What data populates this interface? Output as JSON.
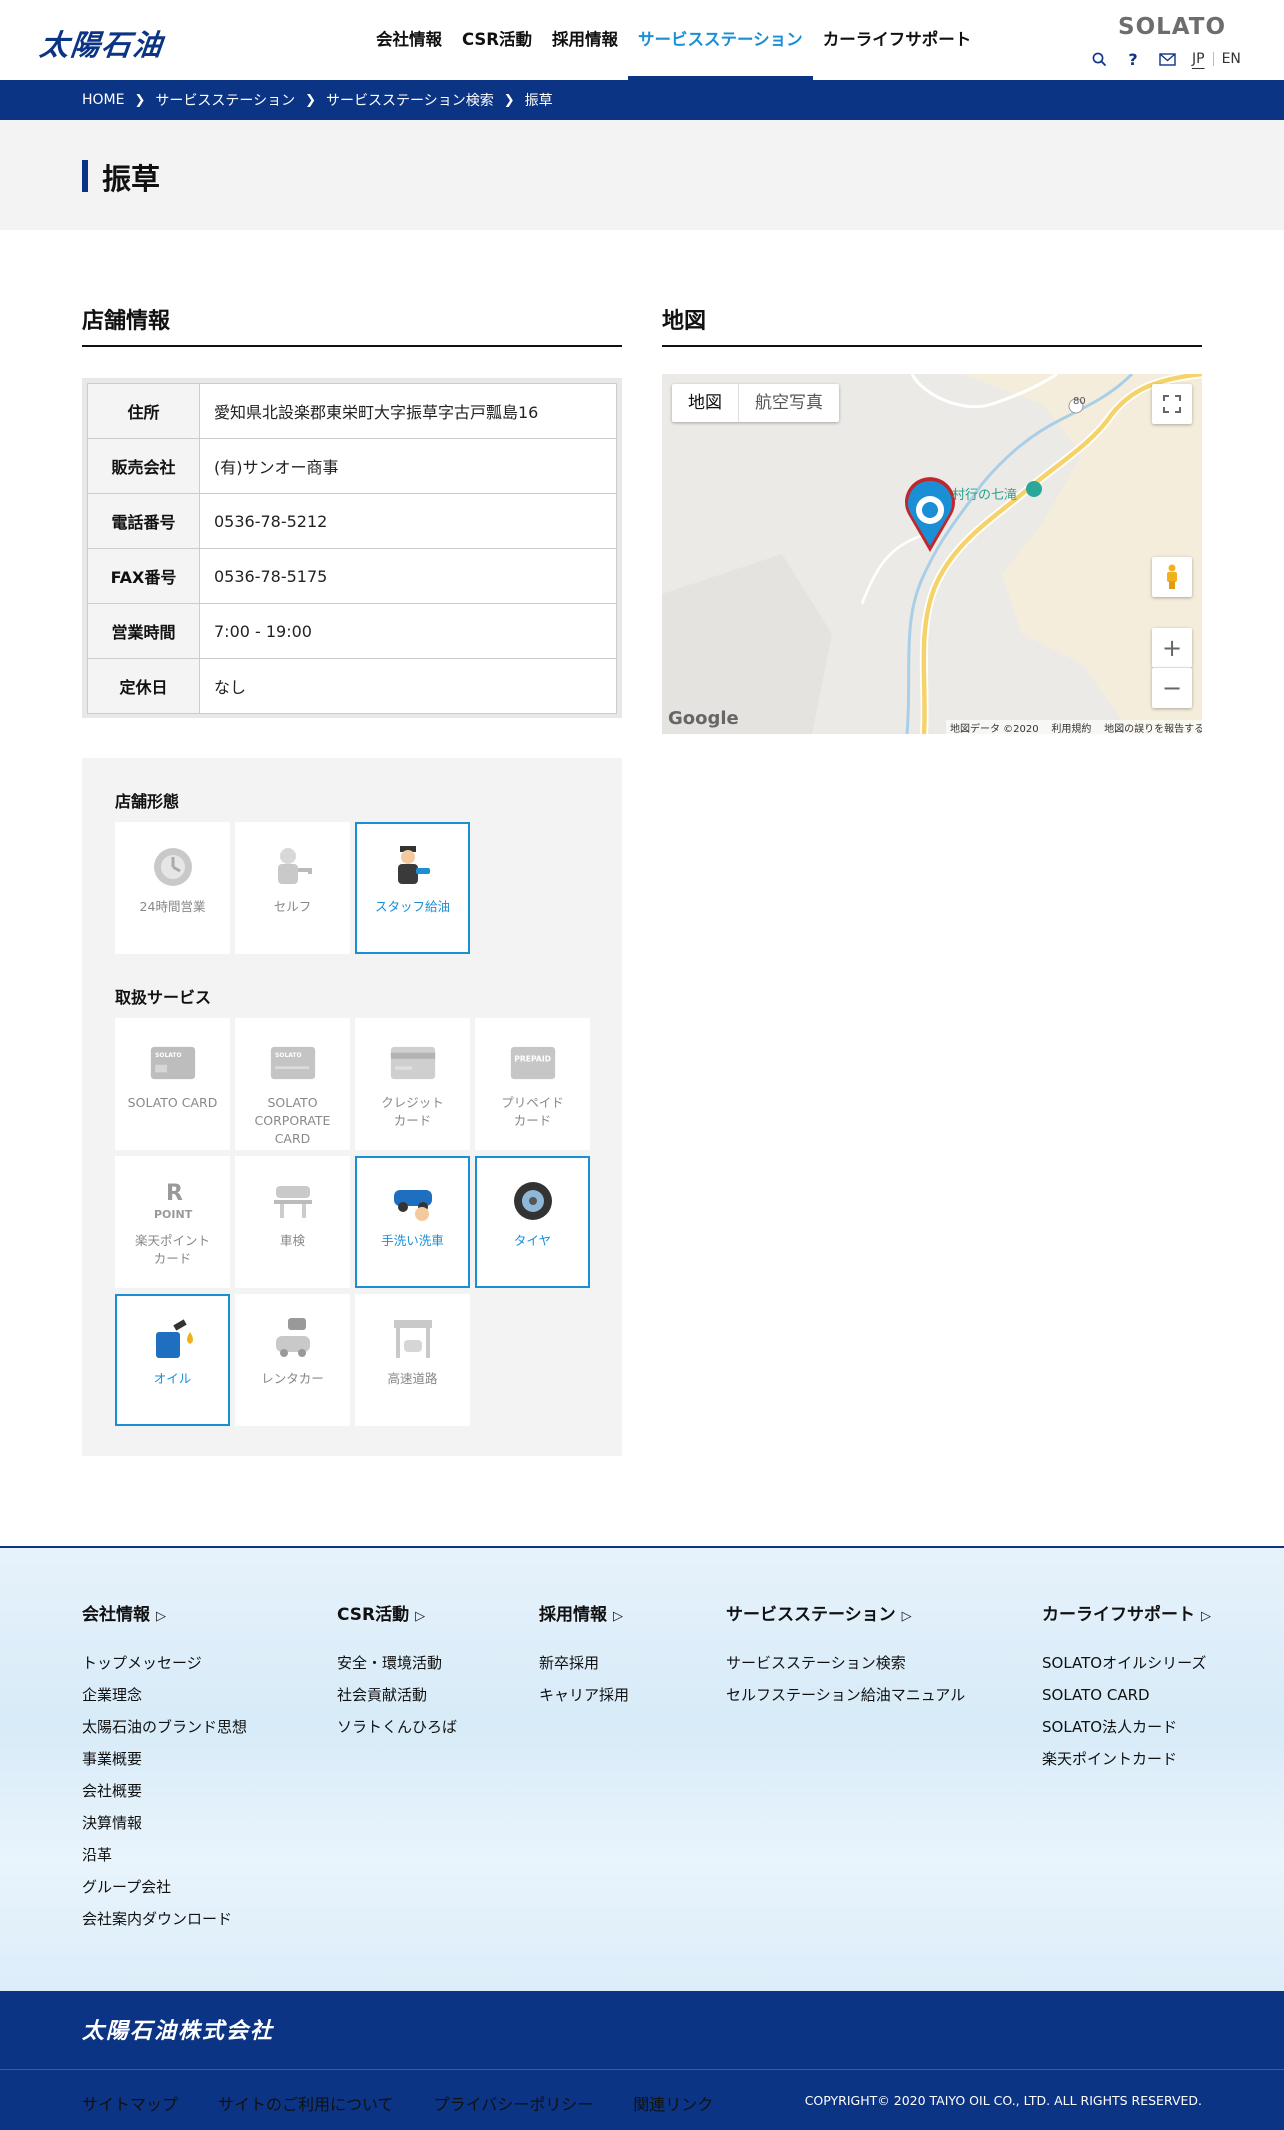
{
  "header": {
    "logo": "太陽石油",
    "brand": "SOLATO",
    "nav": [
      "会社情報",
      "CSR活動",
      "採用情報",
      "サービスステーション",
      "カーライフサポート"
    ],
    "lang_jp": "JP",
    "lang_en": "EN",
    "help_glyph": "?"
  },
  "breadcrumb": [
    "HOME",
    "サービスステーション",
    "サービスステーション検索",
    "振草"
  ],
  "page_title": "振草",
  "store_info": {
    "title": "店舗情報",
    "rows": [
      {
        "label": "住所",
        "value": "愛知県北設楽郡東栄町大字振草字古戸瓢島16"
      },
      {
        "label": "販売会社",
        "value": "(有)サンオー商事"
      },
      {
        "label": "電話番号",
        "value": "0536-78-5212"
      },
      {
        "label": "FAX番号",
        "value": "0536-78-5175"
      },
      {
        "label": "営業時間",
        "value": "7:00 - 19:00"
      },
      {
        "label": "定休日",
        "value": "なし"
      }
    ]
  },
  "store_type": {
    "title": "店舗形態",
    "items": [
      {
        "label": "24時間営業",
        "active": false,
        "icon": "clock-icon"
      },
      {
        "label": "セルフ",
        "active": false,
        "icon": "self-service-icon"
      },
      {
        "label": "スタッフ給油",
        "active": true,
        "icon": "staff-fueling-icon"
      }
    ]
  },
  "services": {
    "title": "取扱サービス",
    "items": [
      {
        "label": "SOLATO CARD",
        "active": false,
        "icon": "solato-card-icon"
      },
      {
        "label": "SOLATO CORPORATE CARD",
        "active": false,
        "icon": "corporate-card-icon"
      },
      {
        "label": "クレジット\nカード",
        "active": false,
        "icon": "credit-card-icon"
      },
      {
        "label": "プリペイド\nカード",
        "active": false,
        "icon": "prepaid-card-icon"
      },
      {
        "label": "楽天ポイント\nカード",
        "active": false,
        "icon": "rakuten-point-icon"
      },
      {
        "label": "車検",
        "active": false,
        "icon": "car-inspection-icon"
      },
      {
        "label": "手洗い洗車",
        "active": true,
        "icon": "car-wash-icon"
      },
      {
        "label": "タイヤ",
        "active": true,
        "icon": "tire-icon"
      },
      {
        "label": "オイル",
        "active": true,
        "icon": "oil-icon"
      },
      {
        "label": "レンタカー",
        "active": false,
        "icon": "rental-car-icon"
      },
      {
        "label": "高速道路",
        "active": false,
        "icon": "highway-icon"
      }
    ]
  },
  "map": {
    "title": "地図",
    "type_map": "地図",
    "type_satellite": "航空写真",
    "poi": "村行の七滝",
    "road_number": "80",
    "google": "Google",
    "attribution": [
      "地図データ ©2020",
      "利用規約",
      "地図の誤りを報告する"
    ],
    "colors": {
      "road": "#f6d36a",
      "river": "#a9cfe8",
      "pin": "#1a8fd6",
      "pin_border": "#c0272d"
    }
  },
  "footer": {
    "columns": [
      {
        "title": "会社情報",
        "links": [
          "トップメッセージ",
          "企業理念",
          "太陽石油のブランド思想",
          "事業概要",
          "会社概要",
          "決算情報",
          "沿革",
          "グループ会社",
          "会社案内ダウンロード"
        ]
      },
      {
        "title": "CSR活動",
        "links": [
          "安全・環境活動",
          "社会貢献活動",
          "ソラトくんひろば"
        ]
      },
      {
        "title": "採用情報",
        "links": [
          "新卒採用",
          "キャリア採用"
        ]
      },
      {
        "title": "サービスステーション",
        "links": [
          "サービスステーション検索",
          "セルフステーション給油マニュアル"
        ]
      },
      {
        "title": "カーライフサポート",
        "links": [
          "SOLATOオイルシリーズ",
          "SOLATO CARD",
          "SOLATO法人カード",
          "楽天ポイントカード"
        ]
      }
    ],
    "company": "太陽石油株式会社",
    "bottom_links": [
      "サイトマップ",
      "サイトのご利用について",
      "プライバシーポリシー",
      "関連リンク"
    ],
    "copyright": "COPYRIGHT© 2020 TAIYO OIL CO., LTD. ALL RIGHTS RESERVED."
  },
  "colors": {
    "brand": "#0c3484",
    "accent": "#1a8fd6"
  }
}
